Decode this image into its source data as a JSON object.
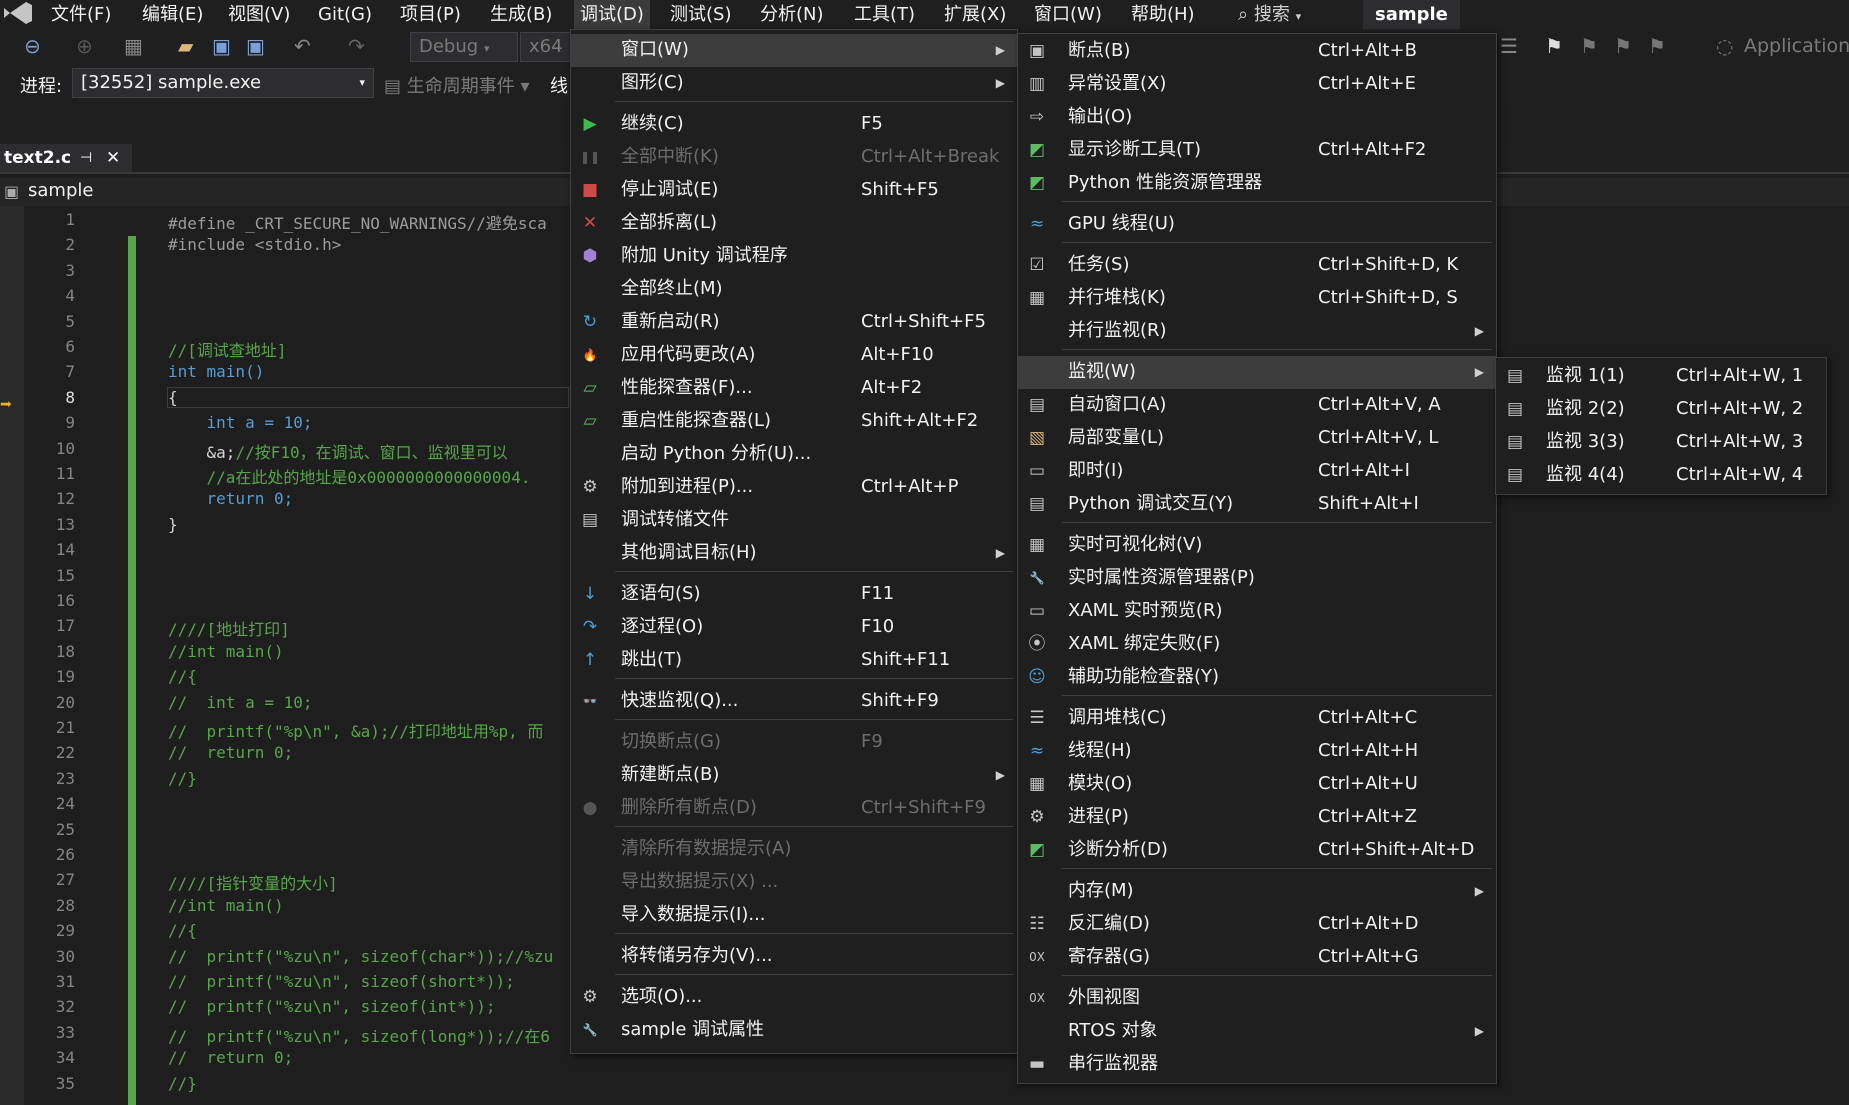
{
  "menubar": {
    "items": [
      "文件(F)",
      "编辑(E)",
      "视图(V)",
      "Git(G)",
      "项目(P)",
      "生成(B)",
      "调试(D)",
      "测试(S)",
      "分析(N)",
      "工具(T)",
      "扩展(X)",
      "窗口(W)",
      "帮助(H)"
    ],
    "search": "搜索",
    "project": "sample"
  },
  "toolbar": {
    "config": "Debug",
    "platform": "x64",
    "app_label": "Application"
  },
  "toolbar2": {
    "process_label": "进程:",
    "process_value": "[32552] sample.exe",
    "lifecycle": "生命周期事件",
    "thread_label": "线"
  },
  "tab": {
    "name": "text2.c"
  },
  "nav": {
    "scope": "sample"
  },
  "editor": {
    "lines": [
      {
        "n": "1",
        "t": "#define _CRT_SECURE_NO_WARNINGS//避免sca",
        "k": "pp"
      },
      {
        "n": "2",
        "t": "#include <stdio.h>",
        "k": "pp"
      },
      {
        "n": "3",
        "t": "",
        "k": ""
      },
      {
        "n": "4",
        "t": "",
        "k": ""
      },
      {
        "n": "5",
        "t": "",
        "k": ""
      },
      {
        "n": "6",
        "t": "//[调试查地址]",
        "k": "cm"
      },
      {
        "n": "7",
        "t": "int main()",
        "k": "kw"
      },
      {
        "n": "8",
        "t": "{",
        "k": ""
      },
      {
        "n": "9",
        "t": "    int a = 10;",
        "k": "kw"
      },
      {
        "n": "10",
        "t": "    &a;//按F10，在调试、窗口、监视里可以",
        "k": "mix"
      },
      {
        "n": "11",
        "t": "    //a在此处的地址是0x0000000000000004.",
        "k": "cm"
      },
      {
        "n": "12",
        "t": "    return 0;",
        "k": "kw"
      },
      {
        "n": "13",
        "t": "}",
        "k": ""
      },
      {
        "n": "14",
        "t": "",
        "k": ""
      },
      {
        "n": "15",
        "t": "",
        "k": ""
      },
      {
        "n": "16",
        "t": "",
        "k": ""
      },
      {
        "n": "17",
        "t": "////[地址打印]",
        "k": "cm"
      },
      {
        "n": "18",
        "t": "//int main()",
        "k": "cm"
      },
      {
        "n": "19",
        "t": "//{",
        "k": "cm"
      },
      {
        "n": "20",
        "t": "//  int a = 10;",
        "k": "cm"
      },
      {
        "n": "21",
        "t": "//  printf(\"%p\\n\", &a);//打印地址用%p, 而",
        "k": "cm"
      },
      {
        "n": "22",
        "t": "//  return 0;",
        "k": "cm"
      },
      {
        "n": "23",
        "t": "//}",
        "k": "cm"
      },
      {
        "n": "24",
        "t": "",
        "k": ""
      },
      {
        "n": "25",
        "t": "",
        "k": ""
      },
      {
        "n": "26",
        "t": "",
        "k": ""
      },
      {
        "n": "27",
        "t": "////[指针变量的大小]",
        "k": "cm"
      },
      {
        "n": "28",
        "t": "//int main()",
        "k": "cm"
      },
      {
        "n": "29",
        "t": "//{",
        "k": "cm"
      },
      {
        "n": "30",
        "t": "//  printf(\"%zu\\n\", sizeof(char*));//%zu",
        "k": "cm"
      },
      {
        "n": "31",
        "t": "//  printf(\"%zu\\n\", sizeof(short*));",
        "k": "cm"
      },
      {
        "n": "32",
        "t": "//  printf(\"%zu\\n\", sizeof(int*));",
        "k": "cm"
      },
      {
        "n": "33",
        "t": "//  printf(\"%zu\\n\", sizeof(long*));//在6",
        "k": "cm"
      },
      {
        "n": "34",
        "t": "//  return 0;",
        "k": "cm"
      },
      {
        "n": "35",
        "t": "//}",
        "k": "cm"
      }
    ]
  },
  "debug_menu": [
    {
      "label": "窗口(W)",
      "shortcut": "",
      "icon": "",
      "sub": true,
      "hl": true
    },
    {
      "label": "图形(C)",
      "shortcut": "",
      "icon": "",
      "sub": true
    },
    {
      "sep": true
    },
    {
      "label": "继续(C)",
      "shortcut": "F5",
      "icon": "play-icon"
    },
    {
      "label": "全部中断(K)",
      "shortcut": "Ctrl+Alt+Break",
      "icon": "pause-icon",
      "dis": true
    },
    {
      "label": "停止调试(E)",
      "shortcut": "Shift+F5",
      "icon": "stop-icon"
    },
    {
      "label": "全部拆离(L)",
      "shortcut": "",
      "icon": "detach-icon"
    },
    {
      "label": "附加 Unity 调试程序",
      "shortcut": "",
      "icon": "unity-icon"
    },
    {
      "label": "全部终止(M)",
      "shortcut": "",
      "icon": ""
    },
    {
      "label": "重新启动(R)",
      "shortcut": "Ctrl+Shift+F5",
      "icon": "restart-icon"
    },
    {
      "label": "应用代码更改(A)",
      "shortcut": "Alt+F10",
      "icon": "hot-reload-icon"
    },
    {
      "label": "性能探查器(F)...",
      "shortcut": "Alt+F2",
      "icon": "profiler-icon"
    },
    {
      "label": "重启性能探查器(L)",
      "shortcut": "Shift+Alt+F2",
      "icon": "profiler-restart-icon"
    },
    {
      "label": "启动 Python 分析(U)...",
      "shortcut": "",
      "icon": ""
    },
    {
      "label": "附加到进程(P)...",
      "shortcut": "Ctrl+Alt+P",
      "icon": "attach-icon"
    },
    {
      "label": "调试转储文件",
      "shortcut": "",
      "icon": "dump-icon"
    },
    {
      "label": "其他调试目标(H)",
      "shortcut": "",
      "icon": "",
      "sub": true
    },
    {
      "sep": true
    },
    {
      "label": "逐语句(S)",
      "shortcut": "F11",
      "icon": "step-into-icon"
    },
    {
      "label": "逐过程(O)",
      "shortcut": "F10",
      "icon": "step-over-icon"
    },
    {
      "label": "跳出(T)",
      "shortcut": "Shift+F11",
      "icon": "step-out-icon"
    },
    {
      "sep": true
    },
    {
      "label": "快速监视(Q)...",
      "shortcut": "Shift+F9",
      "icon": "quickwatch-icon"
    },
    {
      "sep": true
    },
    {
      "label": "切换断点(G)",
      "shortcut": "F9",
      "icon": "",
      "dis": true
    },
    {
      "label": "新建断点(B)",
      "shortcut": "",
      "icon": "",
      "sub": true
    },
    {
      "label": "删除所有断点(D)",
      "shortcut": "Ctrl+Shift+F9",
      "icon": "delete-breakpoints-icon",
      "dis": true
    },
    {
      "sep": true
    },
    {
      "label": "清除所有数据提示(A)",
      "shortcut": "",
      "icon": "",
      "dis": true
    },
    {
      "label": "导出数据提示(X) ...",
      "shortcut": "",
      "icon": "",
      "dis": true
    },
    {
      "label": "导入数据提示(I)...",
      "shortcut": "",
      "icon": ""
    },
    {
      "sep": true
    },
    {
      "label": "将转储另存为(V)...",
      "shortcut": "",
      "icon": ""
    },
    {
      "sep": true
    },
    {
      "label": "选项(O)...",
      "shortcut": "",
      "icon": "gear-icon"
    },
    {
      "label": "sample 调试属性",
      "shortcut": "",
      "icon": "wrench-icon"
    }
  ],
  "window_menu": [
    {
      "label": "断点(B)",
      "shortcut": "Ctrl+Alt+B",
      "icon": "breakpoints-icon"
    },
    {
      "label": "异常设置(X)",
      "shortcut": "Ctrl+Alt+E",
      "icon": "exception-icon"
    },
    {
      "label": "输出(O)",
      "shortcut": "",
      "icon": "output-icon"
    },
    {
      "label": "显示诊断工具(T)",
      "shortcut": "Ctrl+Alt+F2",
      "icon": "diagnostic-icon"
    },
    {
      "label": "Python 性能资源管理器",
      "shortcut": "",
      "icon": "python-perf-icon"
    },
    {
      "sep": true
    },
    {
      "label": "GPU 线程(U)",
      "shortcut": "",
      "icon": "gpu-thread-icon"
    },
    {
      "sep": true
    },
    {
      "label": "任务(S)",
      "shortcut": "Ctrl+Shift+D, K",
      "icon": "tasks-icon"
    },
    {
      "label": "并行堆栈(K)",
      "shortcut": "Ctrl+Shift+D, S",
      "icon": "parallel-stacks-icon"
    },
    {
      "label": "并行监视(R)",
      "shortcut": "",
      "icon": "",
      "sub": true
    },
    {
      "sep": true
    },
    {
      "label": "监视(W)",
      "shortcut": "",
      "icon": "",
      "sub": true,
      "hl": true
    },
    {
      "label": "自动窗口(A)",
      "shortcut": "Ctrl+Alt+V, A",
      "icon": "autos-icon"
    },
    {
      "label": "局部变量(L)",
      "shortcut": "Ctrl+Alt+V, L",
      "icon": "locals-icon"
    },
    {
      "label": "即时(I)",
      "shortcut": "Ctrl+Alt+I",
      "icon": "immediate-icon"
    },
    {
      "label": "Python 调试交互(Y)",
      "shortcut": "Shift+Alt+I",
      "icon": "python-interactive-icon"
    },
    {
      "sep": true
    },
    {
      "label": "实时可视化树(V)",
      "shortcut": "",
      "icon": "visual-tree-icon"
    },
    {
      "label": "实时属性资源管理器(P)",
      "shortcut": "",
      "icon": "property-explorer-icon"
    },
    {
      "label": "XAML 实时预览(R)",
      "shortcut": "",
      "icon": "xaml-preview-icon"
    },
    {
      "label": "XAML 绑定失败(F)",
      "shortcut": "",
      "icon": "xaml-binding-icon"
    },
    {
      "label": "辅助功能检查器(Y)",
      "shortcut": "",
      "icon": "accessibility-icon"
    },
    {
      "sep": true
    },
    {
      "label": "调用堆栈(C)",
      "shortcut": "Ctrl+Alt+C",
      "icon": "call-stack-icon"
    },
    {
      "label": "线程(H)",
      "shortcut": "Ctrl+Alt+H",
      "icon": "threads-icon"
    },
    {
      "label": "模块(O)",
      "shortcut": "Ctrl+Alt+U",
      "icon": "modules-icon"
    },
    {
      "label": "进程(P)",
      "shortcut": "Ctrl+Alt+Z",
      "icon": "processes-icon"
    },
    {
      "label": "诊断分析(D)",
      "shortcut": "Ctrl+Shift+Alt+D",
      "icon": "diagnostic-analysis-icon"
    },
    {
      "sep": true
    },
    {
      "label": "内存(M)",
      "shortcut": "",
      "icon": "",
      "sub": true
    },
    {
      "label": "反汇编(D)",
      "shortcut": "Ctrl+Alt+D",
      "icon": "disassembly-icon"
    },
    {
      "label": "寄存器(G)",
      "shortcut": "Ctrl+Alt+G",
      "icon": "registers-icon"
    },
    {
      "sep": true
    },
    {
      "label": "外围视图",
      "shortcut": "",
      "icon": "peripheral-icon"
    },
    {
      "label": "RTOS 对象",
      "shortcut": "",
      "icon": "",
      "sub": true
    },
    {
      "label": "串行监视器",
      "shortcut": "",
      "icon": "serial-monitor-icon"
    }
  ],
  "watch_menu": [
    {
      "label": "监视 1(1)",
      "shortcut": "Ctrl+Alt+W, 1",
      "icon": "watch-icon"
    },
    {
      "label": "监视 2(2)",
      "shortcut": "Ctrl+Alt+W, 2",
      "icon": "watch-icon"
    },
    {
      "label": "监视 3(3)",
      "shortcut": "Ctrl+Alt+W, 3",
      "icon": "watch-icon"
    },
    {
      "label": "监视 4(4)",
      "shortcut": "Ctrl+Alt+W, 4",
      "icon": "watch-icon"
    }
  ]
}
